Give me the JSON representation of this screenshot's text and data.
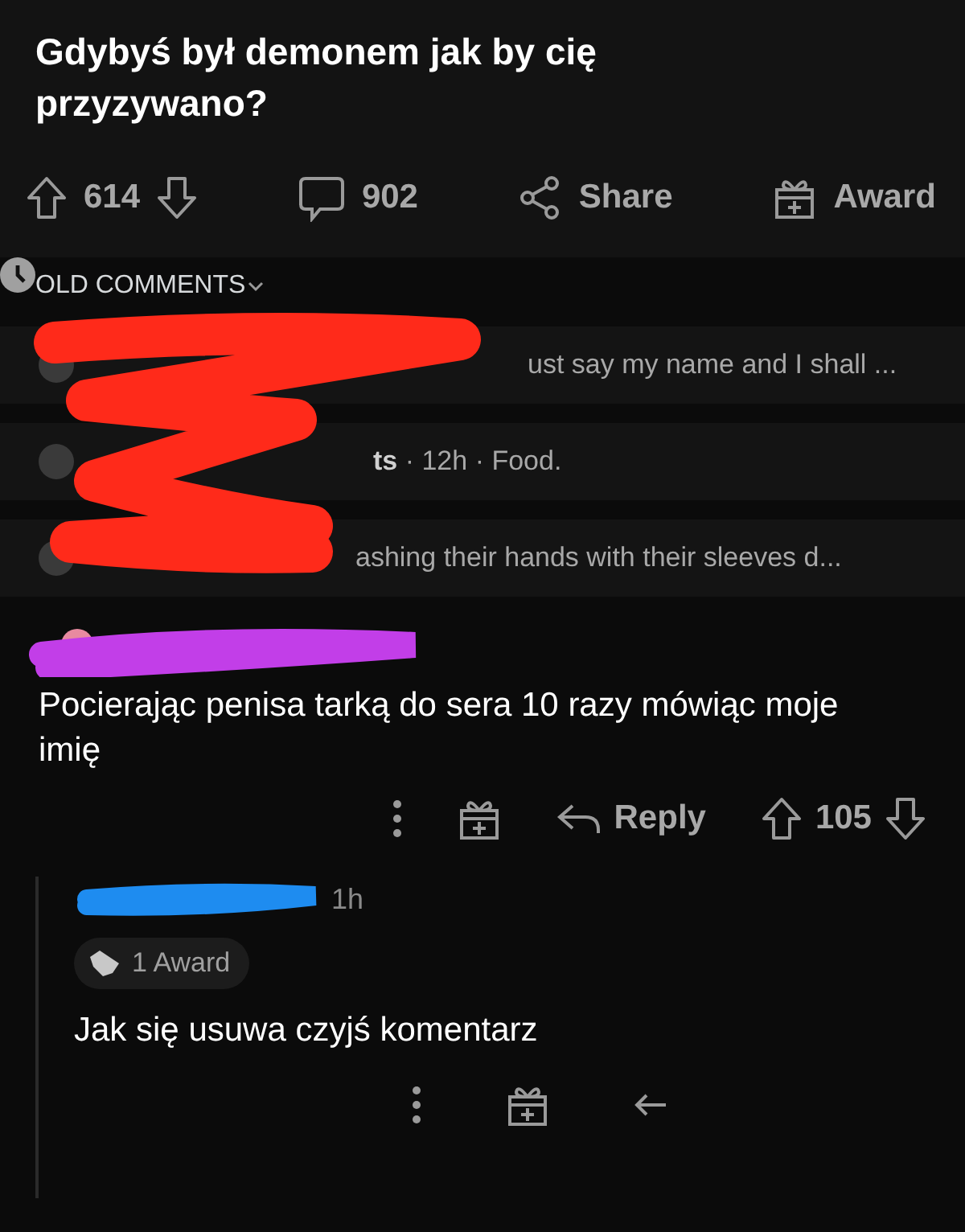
{
  "post": {
    "title": "Gdybyś był demonem jak by cię przyzywano?"
  },
  "post_actions": {
    "score": "614",
    "comments": "902",
    "share": "Share",
    "award": "Award"
  },
  "sort": {
    "label": "OLD COMMENTS"
  },
  "previews": [
    {
      "text": "ust say my name and I shall ..."
    },
    {
      "text": "**ts** · 12h · Food."
    },
    {
      "text": "ashing their hands with their sleeves d..."
    }
  ],
  "comment": {
    "text": "Pocierając penisa tarką do sera 10 razy mówiąc moje imię",
    "reply": "Reply",
    "score": "105"
  },
  "reply": {
    "time": "1h",
    "award": "1 Award",
    "text": "Jak się usuwa czyjś komentarz"
  }
}
